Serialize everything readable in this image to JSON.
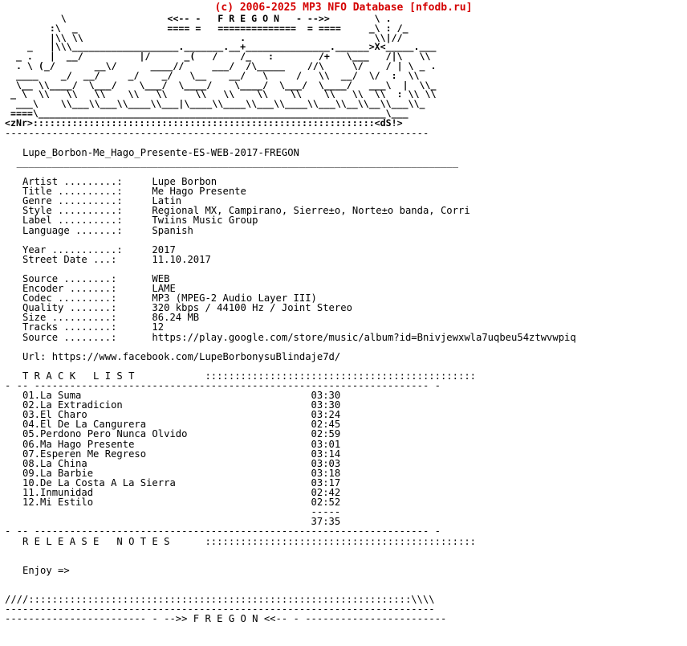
{
  "header": {
    "copyright": "(c) 2006-2025 MP3 NFO Database [nfodb.ru]",
    "color": "#d40000"
  },
  "banner": {
    "group_tag_top": "<<-- -   F R E G O N   - -->>",
    "group_tag_rule": "==== =   ==============  = ====",
    "left_sig": "<zNr>",
    "right_sig": "<dS!>",
    "art_lines": [
      "          \\                  <<-- -   F R E G O N   - -->>        \\ .",
      "        :\\  _                ==== =   ==============  = ====     _\\ : /_",
      "        |\\\\ \\\\                            .                       \\\\|//",
      "    _   |\\\\\\___________________._______.__+_______________.______>X<_____.___",
      "  _ .   |  __/          |/      _(   /    /_   :        /+   \\___   /|\\   \\\\",
      "  . \\ (_/       __\\/      ____//     ___/  /\\_____    //\\     \\/    / | \\ _ .",
      "  ____    _/  __/     _/    _/   \\__    __/   \\     /   \\\\  __/  \\/  :  \\\\",
      "  \\__ \\\\____/  \\___/    \\___/  \\____/    \\____/  \\___/  \\____/   ___\\  |  \\\\_",
      " _ \\  \\\\   \\\\   \\\\    \\\\   \\\\     \\\\   \\\\    \\\\    \\\\    \\\\   \\\\  \\\\  : \\\\ \\\\",
      "  ___\\    \\\\___\\\\___\\\\____\\\\___|\\____\\\\____\\\\___\\\\____\\\\___\\\\__\\\\__\\\\___\\\\_",
      " ====\\______________________________________________________________\\___",
      "<zNr>:::::::::::::::::::::::::::::::::::::::::::::::::::::::::::::<dS!>"
    ]
  },
  "separator": {
    "top_rule": "------------------------------------------------------------------------",
    "release_rule": "___________________________________________________________________________",
    "section_dots": "::::::::::::::::::::::::::::::::::::::::::::::",
    "dash_prefix": "- --",
    "dash_rule": "-------------------------------------------------------------------",
    "dash_suffix": "-"
  },
  "release": {
    "name": "Lupe_Borbon-Me_Hago_Presente-ES-WEB-2017-FREGON"
  },
  "meta_primary": [
    {
      "label": "Artist",
      "dots": ".........",
      "value": "Lupe Borbon"
    },
    {
      "label": "Title",
      "dots": "..........",
      "value": "Me Hago Presente"
    },
    {
      "label": "Genre",
      "dots": "..........",
      "value": "Latin"
    },
    {
      "label": "Style",
      "dots": "..........",
      "value": "Regional MX, Campirano, Sierre±o, Norte±o banda, Corri"
    },
    {
      "label": "Label",
      "dots": "..........",
      "value": "Twiins Music Group"
    },
    {
      "label": "Language",
      "dots": ".......",
      "value": "Spanish"
    }
  ],
  "meta_dates": [
    {
      "label": "Year",
      "dots": "...........",
      "value": "2017"
    },
    {
      "label": "Street Date",
      "dots": "...",
      "value": "11.10.2017"
    }
  ],
  "meta_technical": [
    {
      "label": "Source",
      "dots": "........",
      "value": "WEB"
    },
    {
      "label": "Encoder",
      "dots": ".......",
      "value": "LAME"
    },
    {
      "label": "Codec",
      "dots": ".........",
      "value": "MP3 (MPEG-2 Audio Layer III)"
    },
    {
      "label": "Quality",
      "dots": ".......",
      "value": "320 kbps / 44100 Hz / Joint Stereo"
    },
    {
      "label": "Size",
      "dots": "..........",
      "value": "86.24 MB"
    },
    {
      "label": "Tracks",
      "dots": "........",
      "value": "12"
    },
    {
      "label": "Source",
      "dots": "........",
      "value": "https://play.google.com/store/music/album?id=Bnivjewxwla7uqbeu54ztwvwpiq"
    }
  ],
  "url_line": {
    "label": "Url:",
    "value": "https://www.facebook.com/LupeBorbonysuBlindaje7d/"
  },
  "tracklist": {
    "title": "T R A C K   L I S T",
    "tracks": [
      {
        "num": "01.",
        "title": "La Suma",
        "time": "03:30"
      },
      {
        "num": "02.",
        "title": "La Extradicion",
        "time": "03:30"
      },
      {
        "num": "03.",
        "title": "El Charo",
        "time": "03:24"
      },
      {
        "num": "04.",
        "title": "El De La Cangurera",
        "time": "02:45"
      },
      {
        "num": "05.",
        "title": "Perdono Pero Nunca Olvido",
        "time": "02:59"
      },
      {
        "num": "06.",
        "title": "Ma Hago Presente",
        "time": "03:01"
      },
      {
        "num": "07.",
        "title": "Esperen Me Regreso",
        "time": "03:14"
      },
      {
        "num": "08.",
        "title": "La China",
        "time": "03:03"
      },
      {
        "num": "09.",
        "title": "La Barbie",
        "time": "03:18"
      },
      {
        "num": "10.",
        "title": "De La Costa A La Sierra",
        "time": "03:17"
      },
      {
        "num": "11.",
        "title": "Inmunidad",
        "time": "02:42"
      },
      {
        "num": "12.",
        "title": "Mi Estilo",
        "time": "02:52"
      }
    ],
    "total_rule": "-----",
    "total": "37:35"
  },
  "release_notes": {
    "title": "R E L E A S E   N O T E S",
    "text": "Enjoy =>"
  },
  "footer": {
    "slash_line": "////:::::::::::::::::::::::::::::::::::::::::::::::::::::::::::::::::\\\\\\\\",
    "rule": "-------------------------------------------------------------------------",
    "signature": "------------------------ - -->> F R E G O N <<-- - ------------------------"
  }
}
